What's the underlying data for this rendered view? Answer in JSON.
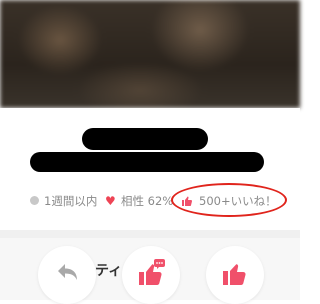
{
  "profile": {
    "meta": {
      "activity": "1週間以内",
      "compatibility": "相性 62%",
      "likes": "500+いいね！"
    }
  },
  "actions": {
    "back_partial_label": "ティ"
  },
  "colors": {
    "accent": "#f0506a",
    "highlight_oval": "#e0241c",
    "heart": "#ee4455"
  },
  "icons": [
    "undo-arrow-icon",
    "thumb-up-message-icon",
    "thumb-up-icon",
    "heart-icon",
    "status-dot-icon"
  ]
}
